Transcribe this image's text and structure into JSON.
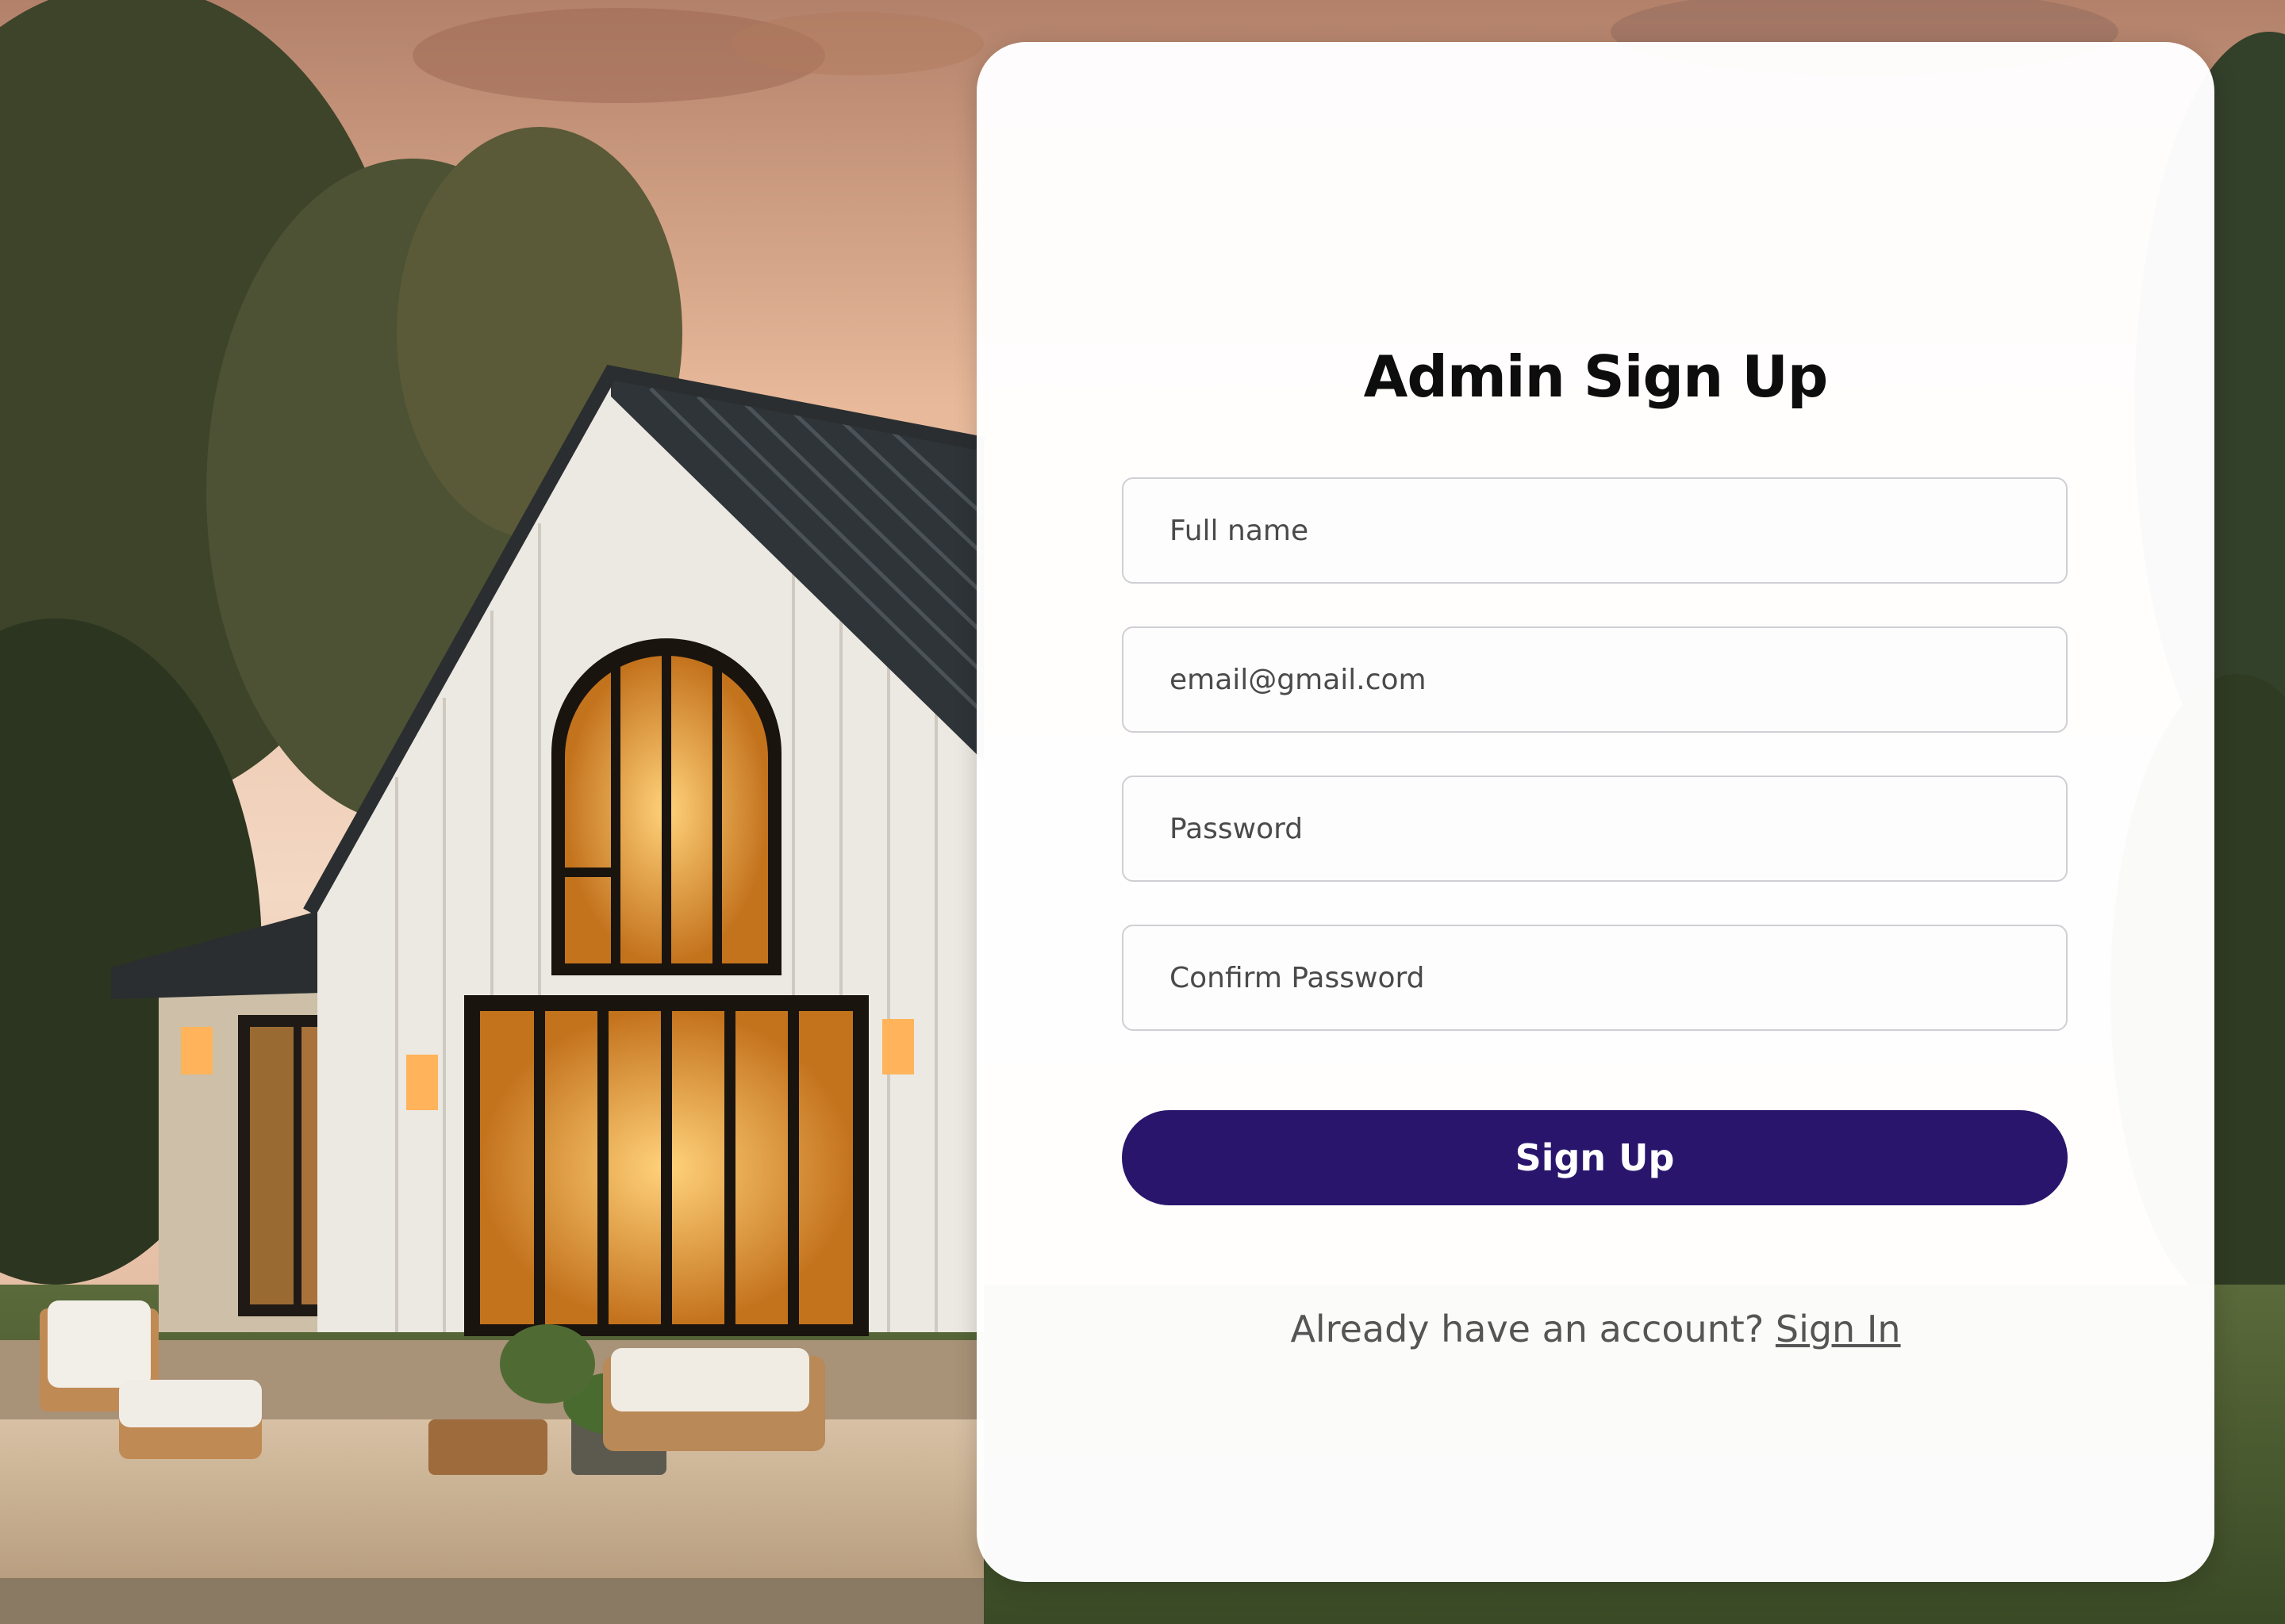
{
  "form": {
    "title": "Admin Sign Up",
    "fields": {
      "full_name_placeholder": "Full name",
      "email_placeholder": "email@gmail.com",
      "password_placeholder": "Password",
      "confirm_password_placeholder": "Confirm Password"
    },
    "submit_label": "Sign Up",
    "footer_text": "Already have an account?",
    "footer_link": "Sign In"
  },
  "colors": {
    "primary_button": "#29166c",
    "card_background": "#ffffff"
  }
}
